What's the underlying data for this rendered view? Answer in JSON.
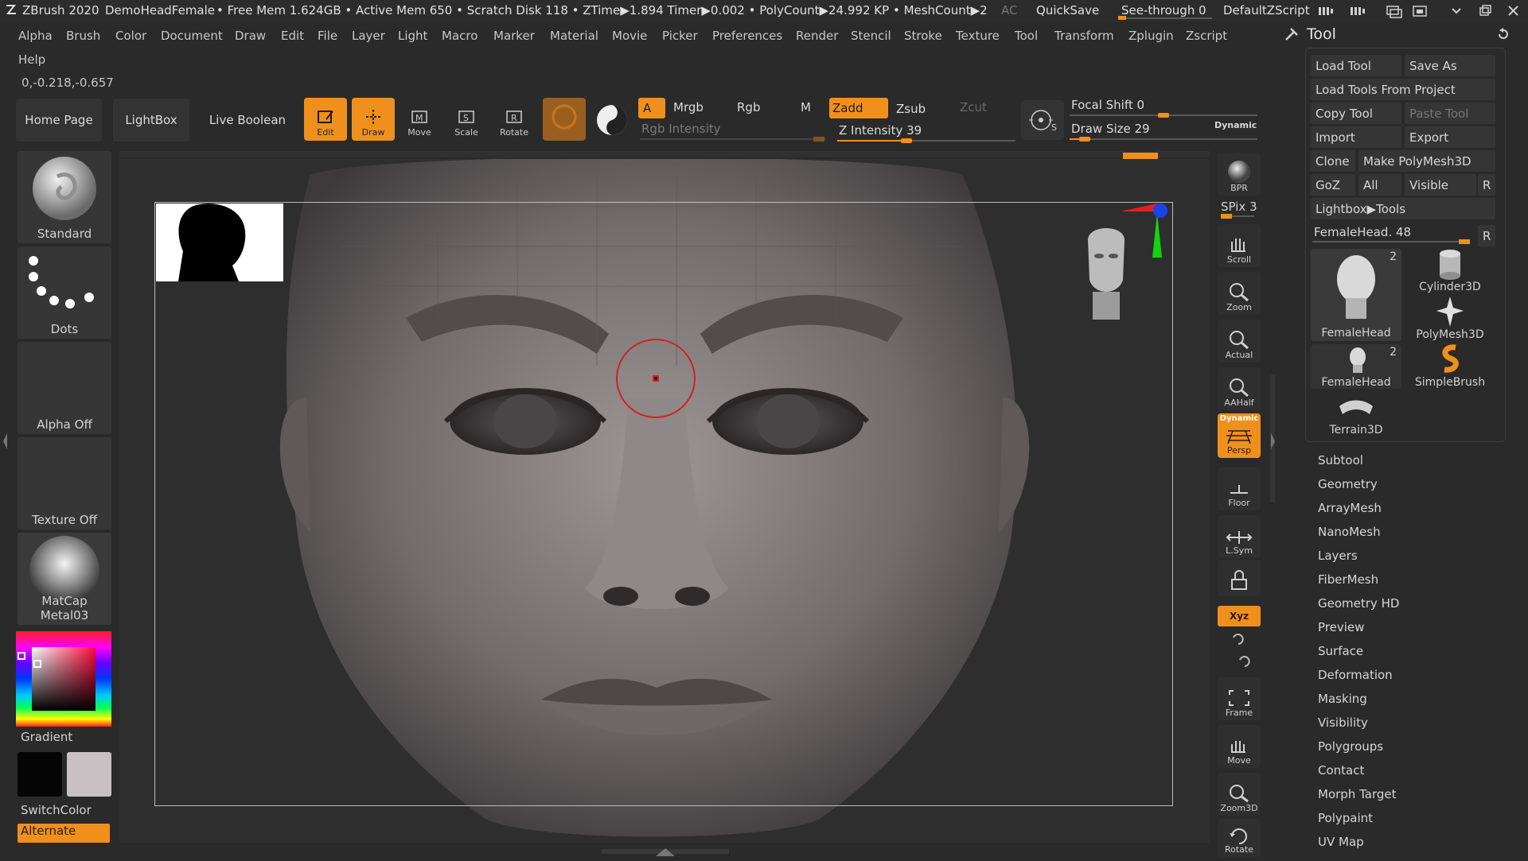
{
  "titlebar": {
    "app": "ZBrush 2020",
    "document": "DemoHeadFemale",
    "stats": "• Free Mem 1.624GB • Active Mem 650 • Scratch Disk 118 •  ZTime▶1.894 Timer▶0.002 • PolyCount▶24.992 KP  • MeshCount▶2",
    "ac": "AC",
    "quicksave": "QuickSave",
    "seethrough_label": "See-through",
    "seethrough_value": "0",
    "script": "DefaultZScript",
    "seethrough_fraction": 0
  },
  "menu": {
    "items": [
      "Alpha",
      "Brush",
      "Color",
      "Document",
      "Draw",
      "Edit",
      "File",
      "Layer",
      "Light",
      "Macro",
      "Marker",
      "Material",
      "Movie",
      "Picker",
      "Preferences",
      "Render",
      "Stencil",
      "Stroke",
      "Texture",
      "Tool",
      "Transform",
      "Zplugin",
      "Zscript"
    ],
    "help": "Help"
  },
  "coords": "0,-0.218,-0.657",
  "toolbar": {
    "home": "Home Page",
    "lightbox": "LightBox",
    "live_boolean": "Live Boolean",
    "edit": "Edit",
    "draw": "Draw",
    "move": "Move",
    "scale": "Scale",
    "rotate": "Rotate",
    "a": "A",
    "mrgb": "Mrgb",
    "rgb": "Rgb",
    "m": "M",
    "zadd": "Zadd",
    "zsub": "Zsub",
    "zcut": "Zcut",
    "rgb_intensity": "Rgb Intensity",
    "z_intensity": "Z Intensity 39",
    "z_intensity_value": 39,
    "focal_shift": "Focal Shift 0",
    "focal_shift_value": 0,
    "draw_size": "Draw Size 29",
    "draw_size_value": 29,
    "dynamic": "Dynamic",
    "s": "S"
  },
  "left_shelf": {
    "brush": "Standard",
    "stroke": "Dots",
    "alpha": "Alpha Off",
    "texture": "Texture Off",
    "material": "MatCap Metal03",
    "gradient": "Gradient",
    "switchcolor": "SwitchColor",
    "alternate": "Alternate"
  },
  "right_shelf": {
    "bpr": "BPR",
    "spix": "SPix 3",
    "scroll": "Scroll",
    "zoom": "Zoom",
    "actual": "Actual",
    "aahalf": "AAHalf",
    "persp_top": "Dynamic",
    "persp": "Persp",
    "floor": "Floor",
    "lsym": "L.Sym",
    "xyz": "Xyz",
    "frame": "Frame",
    "move": "Move",
    "zoom3d": "Zoom3D",
    "rotate": "Rotate"
  },
  "tool_panel": {
    "title": "Tool",
    "buttons": {
      "load_tool": "Load Tool",
      "save_as": "Save As",
      "load_project": "Load Tools From Project",
      "copy_tool": "Copy Tool",
      "paste_tool": "Paste Tool",
      "import": "Import",
      "export": "Export",
      "clone": "Clone",
      "make_polymesh": "Make PolyMesh3D",
      "goz": "GoZ",
      "all": "All",
      "visible": "Visible",
      "r": "R",
      "lightbox_tools": "Lightbox▶Tools",
      "current": "FemaleHead. 48",
      "current_r": "R"
    },
    "tools": [
      {
        "name": "FemaleHead",
        "badge": "2"
      },
      {
        "name": "Cylinder3D",
        "badge": ""
      },
      {
        "name": "PolyMesh3D",
        "badge": ""
      },
      {
        "name": "FemaleHead",
        "badge": "2"
      },
      {
        "name": "SimpleBrush",
        "badge": ""
      },
      {
        "name": "Terrain3D",
        "badge": ""
      }
    ],
    "subpalettes": [
      "Subtool",
      "Geometry",
      "ArrayMesh",
      "NanoMesh",
      "Layers",
      "FiberMesh",
      "Geometry HD",
      "Preview",
      "Surface",
      "Deformation",
      "Masking",
      "Visibility",
      "Polygroups",
      "Contact",
      "Morph Target",
      "Polypaint",
      "UV Map"
    ]
  },
  "colors": {
    "accent": "#f0901c",
    "bg": "#2a2a2a",
    "panel": "#363636"
  }
}
